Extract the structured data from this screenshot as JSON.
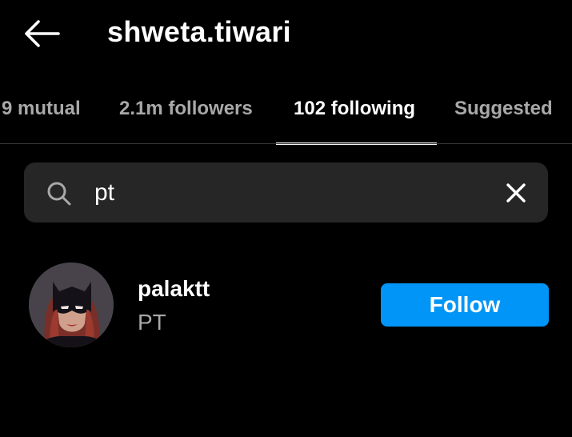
{
  "header": {
    "back_icon": "arrow-left-icon",
    "title": "shweta.tiwari"
  },
  "tabs": [
    {
      "label": "9 mutual",
      "active": false
    },
    {
      "label": "2.1m followers",
      "active": false
    },
    {
      "label": "102 following",
      "active": true
    },
    {
      "label": "Suggested",
      "active": false
    }
  ],
  "search": {
    "icon": "search-icon",
    "value": "pt",
    "clear_icon": "close-icon"
  },
  "results": [
    {
      "username": "palaktt",
      "full_name": "PT",
      "avatar": "batgirl-avatar",
      "action_label": "Follow"
    }
  ],
  "colors": {
    "background": "#000000",
    "search_bg": "#262626",
    "secondary_text": "#a8a8a8",
    "follow_button": "#0095f6"
  }
}
